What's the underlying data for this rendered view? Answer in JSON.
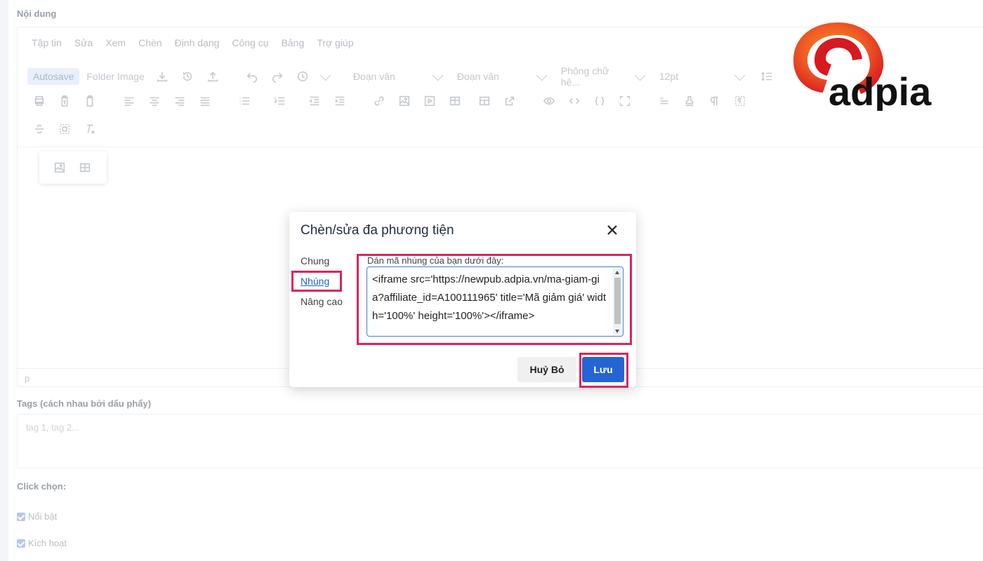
{
  "section_content_label": "Nội dung",
  "menu": [
    "Tập tin",
    "Sửa",
    "Xem",
    "Chèn",
    "Định dạng",
    "Công cụ",
    "Bảng",
    "Trợ giúp"
  ],
  "toolbar": {
    "autosave": "Autosave",
    "folder_image": "Folder Image",
    "block_format_1": "Đoạn văn",
    "block_format_2": "Đoạn văn",
    "font_family": "Phông chữ hệ...",
    "font_size": "12pt"
  },
  "editor": {
    "status_path": "p"
  },
  "tags": {
    "label": "Tags (cách nhau bởi dấu phẩy)",
    "placeholder": "tag 1, tag 2..."
  },
  "click_choose": {
    "label": "Click chọn:",
    "options": [
      {
        "label": "Nổi bật",
        "checked": true
      },
      {
        "label": "Kích hoạt",
        "checked": true
      }
    ]
  },
  "modal": {
    "title": "Chèn/sửa đa phương tiện",
    "tabs": [
      "Chung",
      "Nhúng",
      "Nâng cao"
    ],
    "active_tab": "Nhúng",
    "embed_label": "Dán mã nhúng của bạn dưới đây:",
    "embed_code": "<iframe src='https://newpub.adpia.vn/ma-giam-gia?affiliate_id=A100111965' title='Mã giảm giá' width='100%' height='100%'></iframe>",
    "cancel_label": "Huỷ Bỏ",
    "save_label": "Lưu"
  },
  "logo": {
    "text": "adpia"
  },
  "colors": {
    "primary": "#2464d3",
    "highlight": "#e0225a",
    "logo_red": "#e4262b",
    "logo_orange": "#f7941d"
  }
}
